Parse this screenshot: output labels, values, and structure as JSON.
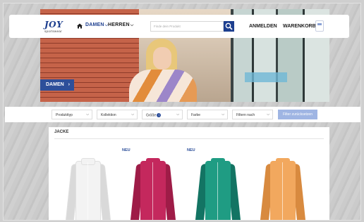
{
  "header": {
    "logo_text": "JOY",
    "logo_sub": "sportswear",
    "nav": [
      {
        "label": "DAMEN",
        "active": true
      },
      {
        "label": "HERREN",
        "active": false
      }
    ],
    "search_placeholder": "Finde dein Produkt",
    "login_label": "ANMELDEN",
    "cart_label": "WARENKORB"
  },
  "hero": {
    "tag_label": "DAMEN",
    "tag_arrow": "›"
  },
  "filters": [
    {
      "label": "Produkttyp"
    },
    {
      "label": "Kollektion"
    },
    {
      "label": "Größe",
      "info": true
    },
    {
      "label": "Farbe"
    },
    {
      "label": "Filtern nach"
    }
  ],
  "reset_label": "Filter zurücksetzen",
  "category_title": "JACKE",
  "products": [
    {
      "badge": "",
      "color": "#f3f3f3",
      "shade": "#d9d9d9"
    },
    {
      "badge": "NEU",
      "color": "#c4285d",
      "shade": "#9e1c47"
    },
    {
      "badge": "NEU",
      "color": "#1f9c83",
      "shade": "#137463"
    },
    {
      "badge": "",
      "color": "#f2a85e",
      "shade": "#d88a3f"
    }
  ],
  "colors": {
    "brand": "#1d3f8f",
    "accent": "#2d4f9a",
    "reset_button": "#9fb5e3"
  },
  "icons": {
    "home": "home-icon",
    "search": "search-icon",
    "cart": "cart-icon",
    "info": "info-icon",
    "chevron": "chevron-down-icon"
  }
}
